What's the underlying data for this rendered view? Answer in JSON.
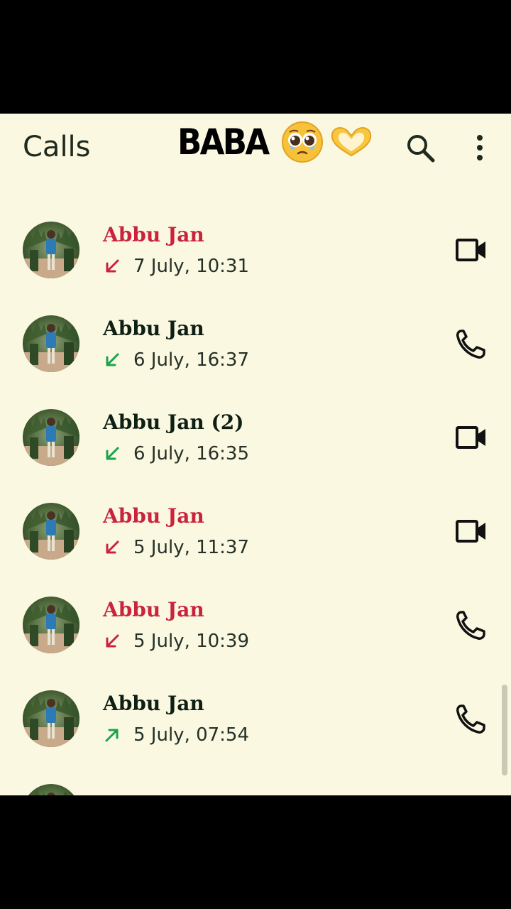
{
  "header": {
    "title": "Calls",
    "overlay_text": "BABA"
  },
  "icons": {
    "search": "search-icon",
    "more": "more-vert-icon",
    "video": "videocam-icon",
    "voice": "phone-icon",
    "incoming": "call-received-icon",
    "outgoing": "call-made-icon"
  },
  "colors": {
    "background": "#fbf8e2",
    "missed": "#c9243d",
    "received": "#1aa350",
    "outgoing": "#1aa350",
    "name": "#0e1f14"
  },
  "calls": [
    {
      "name": "Abbu Jan",
      "time": "7 July, 10:31",
      "status": "missed",
      "direction": "incoming",
      "type": "video"
    },
    {
      "name": "Abbu Jan",
      "time": "6 July, 16:37",
      "status": "received",
      "direction": "incoming",
      "type": "voice"
    },
    {
      "name": "Abbu Jan (2)",
      "time": "6 July, 16:35",
      "status": "received",
      "direction": "incoming",
      "type": "video"
    },
    {
      "name": "Abbu Jan",
      "time": "5 July, 11:37",
      "status": "missed",
      "direction": "incoming",
      "type": "video"
    },
    {
      "name": "Abbu Jan",
      "time": "5 July, 10:39",
      "status": "missed",
      "direction": "incoming",
      "type": "voice"
    },
    {
      "name": "Abbu Jan",
      "time": "5 July, 07:54",
      "status": "outgoing",
      "direction": "outgoing",
      "type": "voice"
    }
  ]
}
